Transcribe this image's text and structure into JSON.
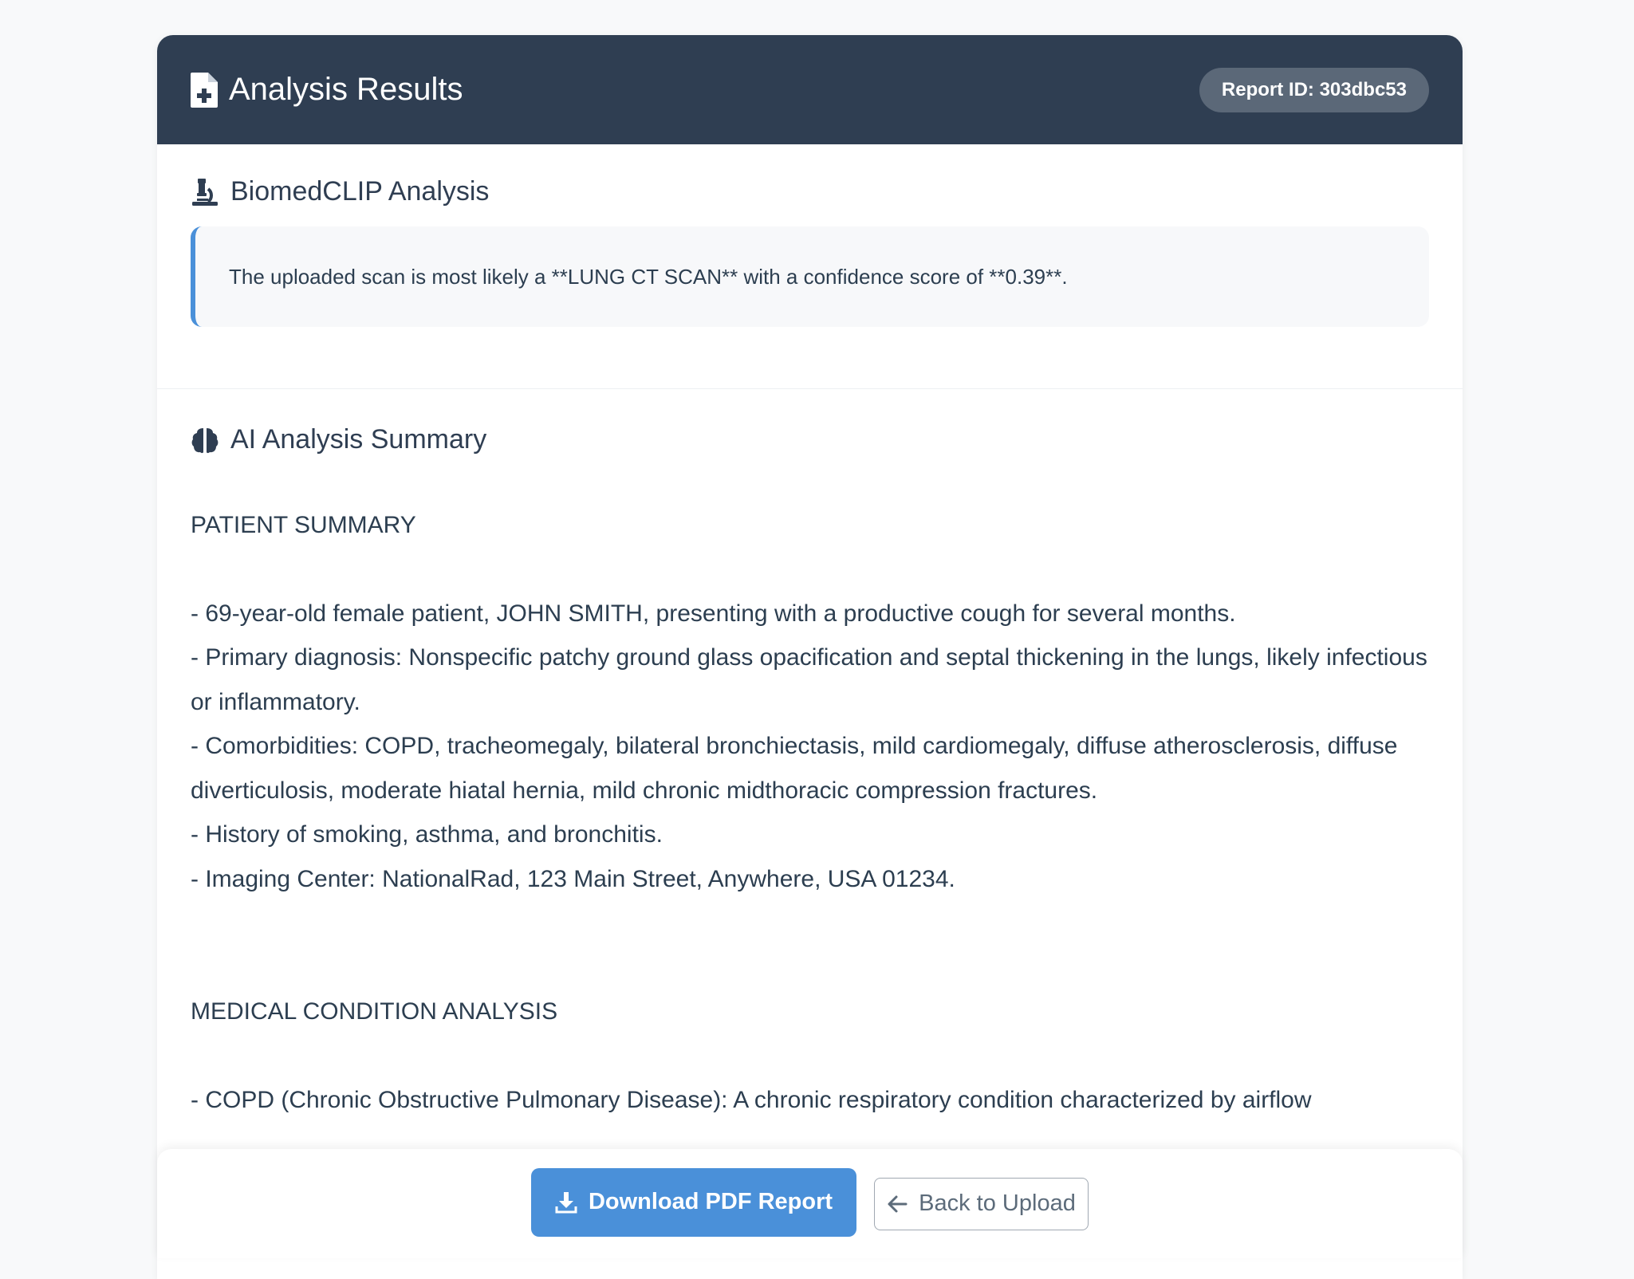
{
  "header": {
    "title": "Analysis Results",
    "report_id": "Report ID: 303dbc53",
    "icon": "file-medical-icon"
  },
  "biomed": {
    "title": "BiomedCLIP Analysis",
    "icon": "microscope-icon",
    "result": "The uploaded scan is most likely a **LUNG CT SCAN** with a confidence score of **0.39**."
  },
  "summary": {
    "title": "AI Analysis Summary",
    "icon": "brain-icon",
    "patient_heading": "PATIENT SUMMARY",
    "patient_items": [
      "- 69-year-old female patient, JOHN SMITH, presenting with a productive cough for several months.",
      "- Primary diagnosis: Nonspecific patchy ground glass opacification and septal thickening in the lungs, likely infectious or inflammatory.",
      "- Comorbidities: COPD, tracheomegaly, bilateral bronchiectasis, mild cardiomegaly, diffuse atherosclerosis, diffuse diverticulosis, moderate hiatal hernia, mild chronic midthoracic compression fractures.",
      "- History of smoking, asthma, and bronchitis.",
      "- Imaging Center: NationalRad, 123 Main Street, Anywhere, USA 01234."
    ],
    "condition_heading": "MEDICAL CONDITION ANALYSIS",
    "condition_items": [
      "- COPD (Chronic Obstructive Pulmonary Disease): A chronic respiratory condition characterized by airflow"
    ]
  },
  "actions": {
    "download_label": "Download PDF Report",
    "back_label": "Back to Upload"
  },
  "colors": {
    "header_bg": "#2f3e52",
    "accent": "#4a90d9"
  }
}
